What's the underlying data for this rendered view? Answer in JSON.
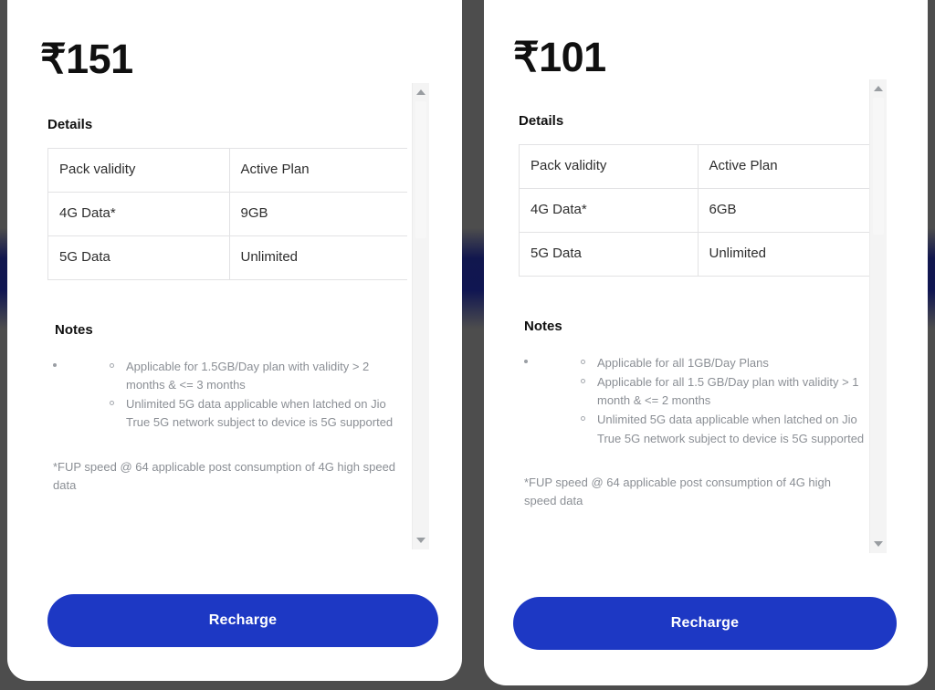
{
  "theme": {
    "backdrop_color": "#4d4d4d",
    "backdrop_band_color": "#0d1352",
    "card_background": "#ffffff",
    "brand_blue": "#1d38c4",
    "heading_color": "#101010",
    "table_text_color": "#2d2d2d",
    "table_border_color": "#e2e2e4",
    "notes_text_color": "#8b8f95",
    "scrollbar_track_color": "#f4f4f4",
    "scrollbar_arrow_color": "#999da1"
  },
  "cards": [
    {
      "id": "plan-151",
      "price": "₹151",
      "details_heading": "Details",
      "details_rows": [
        {
          "key": "Pack validity",
          "value": "Active Plan"
        },
        {
          "key": "4G Data*",
          "value": "9GB"
        },
        {
          "key": "5G Data",
          "value": "Unlimited"
        }
      ],
      "notes_heading": "Notes",
      "notes": [
        "Applicable for 1.5GB/Day plan  with validity > 2 months & <= 3 months",
        "Unlimited 5G data applicable when latched on Jio True 5G network subject to device is 5G supported"
      ],
      "footnote": "*FUP speed @ 64 applicable post consumption of 4G high speed data",
      "cta_label": "Recharge",
      "scroll_up_icon": "triangle-up-icon",
      "scroll_down_icon": "triangle-down-icon"
    },
    {
      "id": "plan-101",
      "price": "₹101",
      "details_heading": "Details",
      "details_rows": [
        {
          "key": "Pack validity",
          "value": "Active Plan"
        },
        {
          "key": "4G Data*",
          "value": "6GB"
        },
        {
          "key": "5G Data",
          "value": "Unlimited"
        }
      ],
      "notes_heading": "Notes",
      "notes": [
        "Applicable for all 1GB/Day Plans",
        "Applicable for all 1.5 GB/Day plan with validity > 1 month & <= 2 months",
        "Unlimited 5G data applicable when latched on Jio True 5G network subject to device is 5G supported"
      ],
      "footnote": "*FUP speed @ 64 applicable post consumption of 4G high speed data",
      "cta_label": "Recharge",
      "scroll_up_icon": "triangle-up-icon",
      "scroll_down_icon": "triangle-down-icon"
    }
  ]
}
